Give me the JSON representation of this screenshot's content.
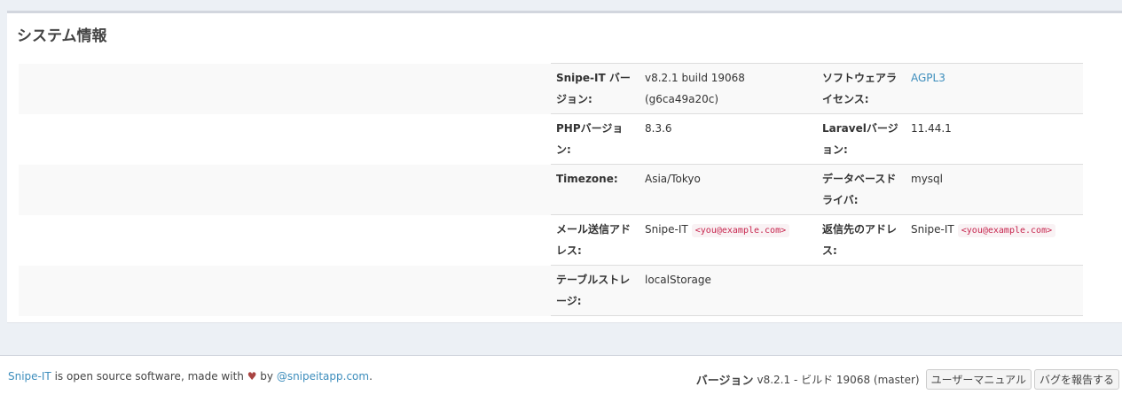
{
  "panel": {
    "title": "システム情報"
  },
  "rows": [
    {
      "l1": "Snipe-IT バージョン:",
      "v1": "v8.2.1 build 19068 (g6ca49a20c)",
      "l2": "ソフトウェアライセンス:",
      "v2": "AGPL3"
    },
    {
      "l1": "PHPバージョン:",
      "v1": "8.3.6",
      "l2": "Laravelバージョン:",
      "v2": "11.44.1"
    },
    {
      "l1": "Timezone:",
      "v1": "Asia/Tokyo",
      "l2": "データベースドライバ:",
      "v2": "mysql"
    },
    {
      "l1": "メール送信アドレス:",
      "v1": "Snipe-IT",
      "v1_email": "<you@example.com>",
      "l2": "返信先のアドレス:",
      "v2": "Snipe-IT",
      "v2_email": "<you@example.com>"
    },
    {
      "l1": "テーブルストレージ:",
      "v1": "localStorage"
    }
  ],
  "footer": {
    "app_link": "Snipe-IT",
    "text_mid": " is open source software, made with ",
    "heart": "♥",
    "text_by": " by ",
    "author_link": "@snipeitapp.com",
    "text_end": ".",
    "version_label": "バージョン",
    "version_text": "v8.2.1 - ビルド 19068 (master)",
    "manual_button": "ユーザーマニュアル",
    "bug_button": "バグを報告する"
  },
  "colors": {
    "link": "#3c8dbc",
    "heart": "#a94442",
    "code": "#c7254e"
  }
}
